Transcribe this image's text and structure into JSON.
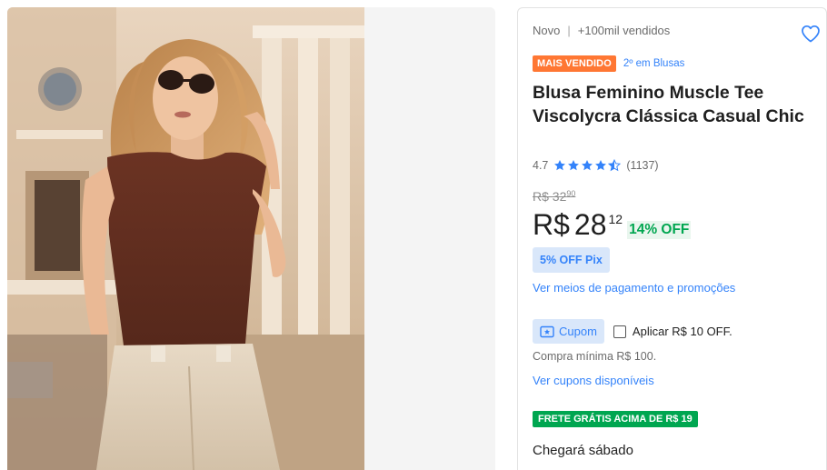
{
  "product": {
    "condition": "Novo",
    "separator": "|",
    "sold": "+100mil vendidos",
    "best_seller_badge": "MAIS VENDIDO",
    "category_rank": "2º em Blusas",
    "title": "Blusa Feminino Muscle Tee Viscolycra Clássica Casual Chic",
    "rating": "4.7",
    "rating_value": 4.7,
    "reviews": "(1137)"
  },
  "pricing": {
    "old_price": "R$ 32",
    "old_cents": "90",
    "currency": "R$",
    "price_int": "28",
    "price_cents": "12",
    "discount": "14% OFF",
    "pix_badge": "5% OFF Pix",
    "payment_link": "Ver meios de pagamento e promoções"
  },
  "coupon": {
    "chip_label": "Cupom",
    "apply_label": "Aplicar R$ 10 OFF.",
    "min_purchase": "Compra mínima R$ 100.",
    "see_coupons": "Ver cupons disponíveis"
  },
  "shipping": {
    "free_badge": "FRETE GRÁTIS ACIMA DE R$ 19",
    "arrival": "Chegará sábado"
  },
  "icons": {
    "favorite": "heart-outline-icon",
    "star": "star-icon",
    "coupon": "ticket-icon"
  },
  "colors": {
    "accent_blue": "#3483fa",
    "badge_orange": "#ff7733",
    "green": "#00a650"
  }
}
